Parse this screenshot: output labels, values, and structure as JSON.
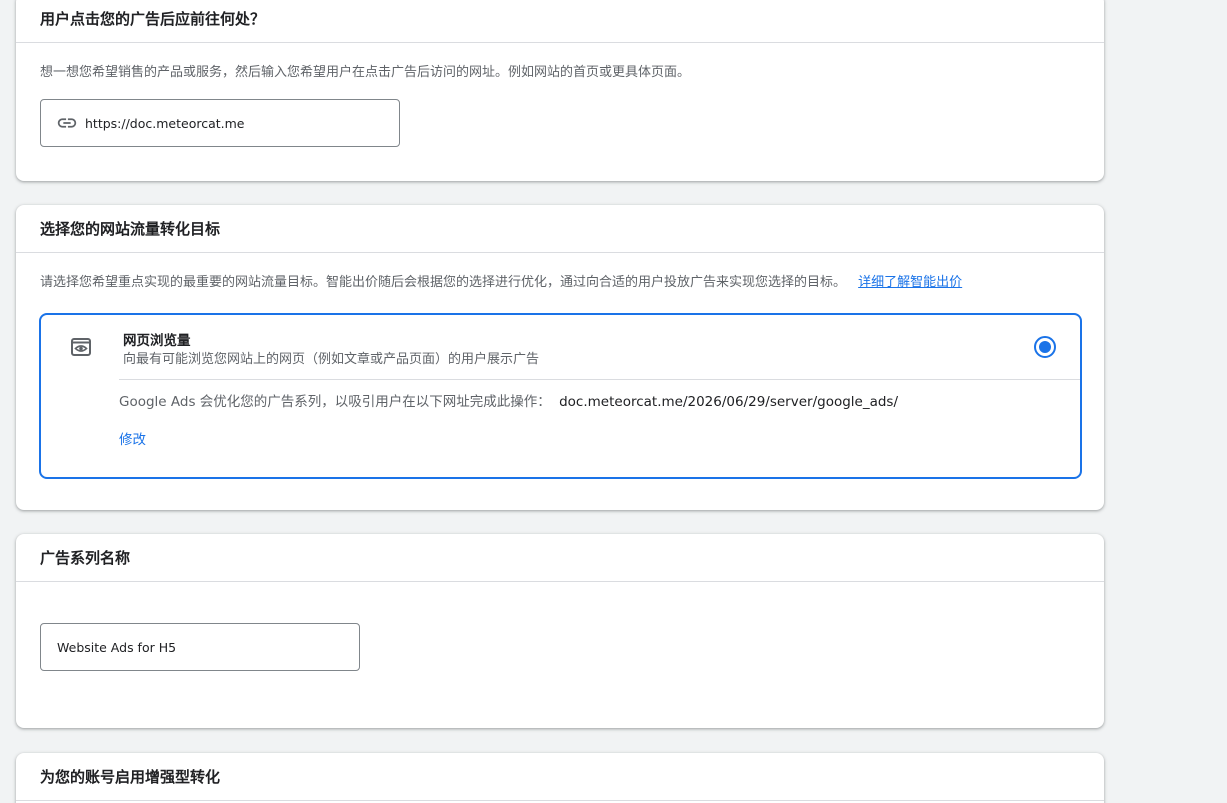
{
  "url_section": {
    "title": "用户点击您的广告后应前往何处？",
    "description": "想一想您希望销售的产品或服务，然后输入您希望用户在点击广告后访问的网址。例如网站的首页或更具体页面。",
    "url_value": "https://doc.meteorcat.me",
    "link_icon": "link-icon"
  },
  "goal_section": {
    "title": "选择您的网站流量转化目标",
    "description": "请选择您希望重点实现的最重要的网站流量目标。智能出价随后会根据您的选择进行优化，通过向合适的用户投放广告来实现您选择的目标。",
    "learn_more": "详细了解智能出价",
    "option": {
      "icon": "eye-frame-icon",
      "title": "网页浏览量",
      "subtitle": "向最有可能浏览您网站上的网页（例如文章或产品页面）的用户展示广告",
      "selected": true,
      "optimize_text": "Google Ads 会优化您的广告系列，以吸引用户在以下网址完成此操作：",
      "optimize_url": "doc.meteorcat.me/2026/06/29/server/google_ads/",
      "edit_label": "修改"
    }
  },
  "name_section": {
    "title": "广告系列名称",
    "campaign_name": "Website Ads for H5"
  },
  "enhanced_section": {
    "title": "为您的账号启用增强型转化"
  },
  "colors": {
    "accent": "#1a73e8",
    "background": "#f1f3f4",
    "text": "#202124",
    "muted": "#5f6368"
  }
}
